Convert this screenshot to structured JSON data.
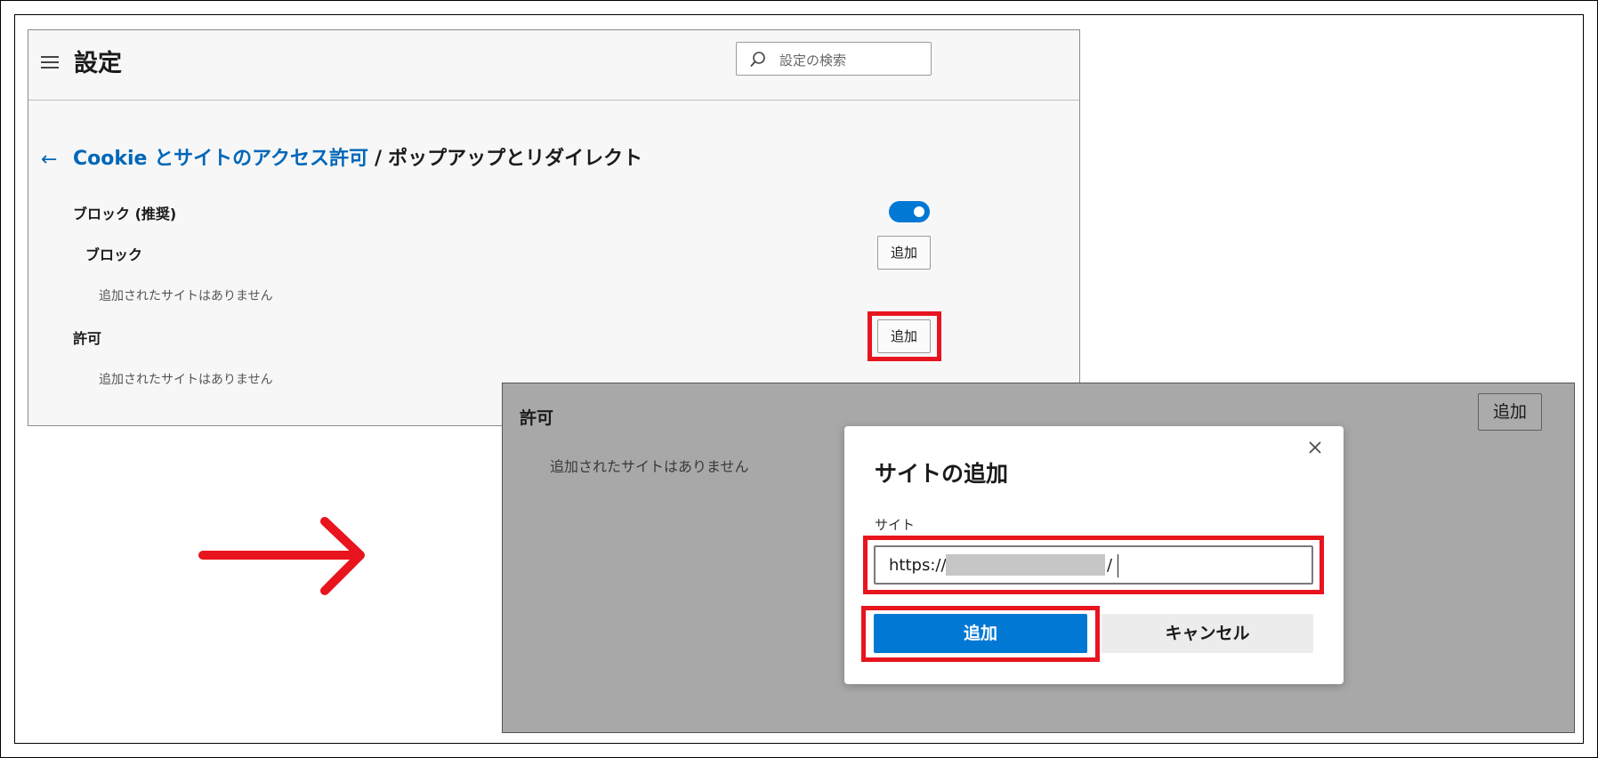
{
  "settings": {
    "title": "設定",
    "search_placeholder": "設定の検索",
    "breadcrumb": {
      "back_link": "Cookie とサイトのアクセス許可",
      "separator": "/",
      "current": "ポップアップとリダイレクト"
    },
    "block_recommended_label": "ブロック (推奨)",
    "block_toggle_on": true,
    "block_label": "ブロック",
    "block_add_label": "追加",
    "block_empty": "追加されたサイトはありません",
    "allow_label": "許可",
    "allow_add_label": "追加",
    "allow_empty": "追加されたサイトはありません"
  },
  "background_panel": {
    "label": "許可",
    "add_label": "追加",
    "empty": "追加されたサイトはありません"
  },
  "dialog": {
    "title": "サイトの追加",
    "field_label": "サイト",
    "input_prefix": "https://",
    "input_suffix": "/",
    "add_button": "追加",
    "cancel_button": "キャンセル",
    "close_icon": "close-icon"
  },
  "colors": {
    "accent": "#0078d4",
    "link": "#0067b8",
    "highlight": "#e8141e",
    "arrow": "#e8141e"
  }
}
